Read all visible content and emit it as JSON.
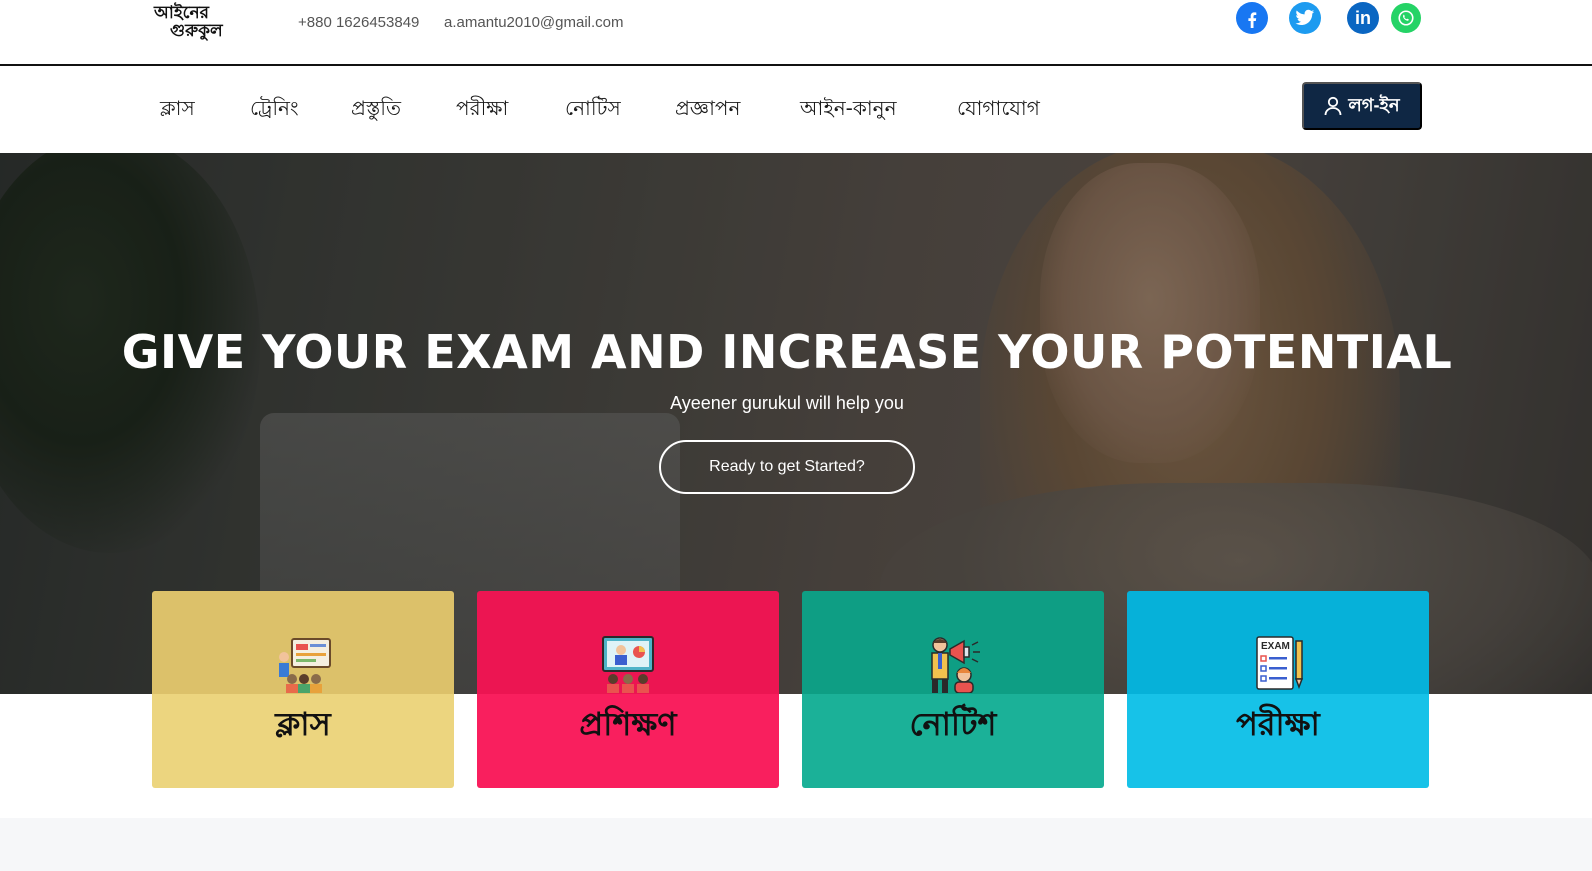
{
  "topbar": {
    "logo_line1": "আইনের",
    "logo_line2": "গুরুকুল",
    "phone": "+880 1626453849",
    "email": "a.amantu2010@gmail.com",
    "social": [
      "facebook-icon",
      "twitter-icon",
      "linkedin-icon",
      "whatsapp-icon"
    ],
    "linkedin_text": "in"
  },
  "nav": {
    "items": [
      "ক্লাস",
      "ট্রেনিং",
      "প্রস্তুতি",
      "পরীক্ষা",
      "নোটিস",
      "প্রজ্ঞাপন",
      "আইন-কানুন",
      "যোগাযোগ"
    ],
    "login_label": "লগ-ইন"
  },
  "hero": {
    "title": "GIVE YOUR EXAM AND INCREASE YOUR POTENTIAL",
    "subtitle": "Ayeener gurukul will help you",
    "cta": "Ready to get Started?"
  },
  "cards": [
    {
      "label": "ক্লাস",
      "icon": "classroom-icon",
      "color_top": "#dcc16a",
      "color_bottom": "#ecd57f"
    },
    {
      "label": "প্রশিক্ষণ",
      "icon": "training-presentation-icon",
      "color_top": "#ec1552",
      "color_bottom": "#f91f5e"
    },
    {
      "label": "নোটিশ",
      "icon": "megaphone-notice-icon",
      "color_top": "#0e9e84",
      "color_bottom": "#1bb198"
    },
    {
      "label": "পরীক্ষা",
      "icon": "exam-sheet-icon",
      "color_top": "#06b1d9",
      "color_bottom": "#17c2e8"
    }
  ]
}
